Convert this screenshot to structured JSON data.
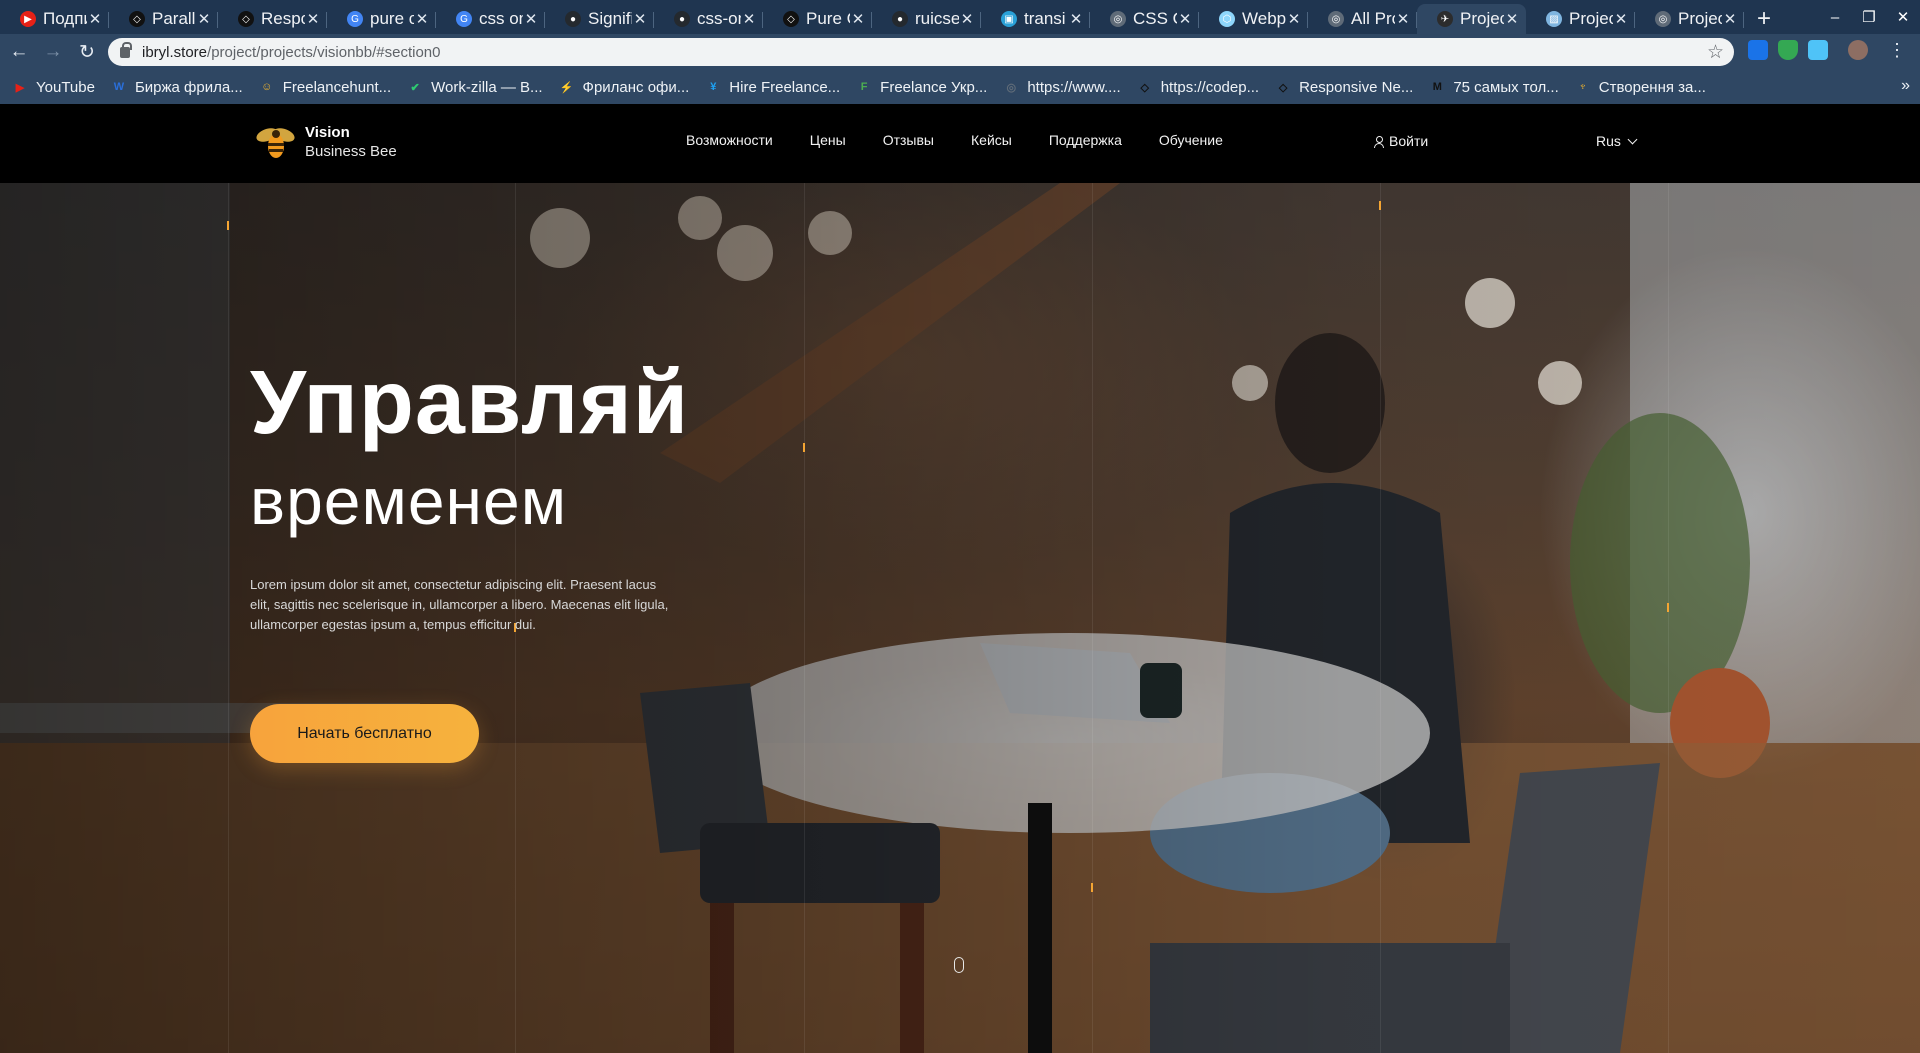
{
  "browser": {
    "tabs": [
      {
        "title": "Подпи",
        "color": "#e62117",
        "glyph": "▶"
      },
      {
        "title": "Paralla",
        "color": "#111111",
        "glyph": "◇"
      },
      {
        "title": "Respo",
        "color": "#111111",
        "glyph": "◇"
      },
      {
        "title": "pure c",
        "color": "#4285f4",
        "glyph": "G"
      },
      {
        "title": "css on",
        "color": "#4285f4",
        "glyph": "G"
      },
      {
        "title": "Signifi",
        "color": "#24292e",
        "glyph": "●"
      },
      {
        "title": "css-on",
        "color": "#24292e",
        "glyph": "●"
      },
      {
        "title": "Pure C",
        "color": "#111111",
        "glyph": "◇"
      },
      {
        "title": "ruicse",
        "color": "#24292e",
        "glyph": "●"
      },
      {
        "title": "transi",
        "color": "#2aa1d8",
        "glyph": "▣"
      },
      {
        "title": "CSS O",
        "color": "#5f6b78",
        "glyph": "◎"
      },
      {
        "title": "Webp",
        "color": "#8ed6fb",
        "glyph": "⬡"
      },
      {
        "title": "All Pro",
        "color": "#5f6b78",
        "glyph": "◎"
      },
      {
        "title": "Projec",
        "color": "#2c2c2c",
        "glyph": "✈",
        "active": true
      },
      {
        "title": "Projec",
        "color": "#7fb5e0",
        "glyph": "▨"
      },
      {
        "title": "Projec",
        "color": "#5f6b78",
        "glyph": "◎"
      }
    ],
    "new_tab_label": "+",
    "url_host": "ibryl.store",
    "url_path": "/project/projects/visionbb/#section0",
    "bookmarks": [
      {
        "label": "YouTube",
        "color": "#e62117",
        "glyph": "▶"
      },
      {
        "label": "Биржа фрила...",
        "color": "#2a6fdb",
        "glyph": "W"
      },
      {
        "label": "Freelancehunt...",
        "color": "#f3b52c",
        "glyph": "☺"
      },
      {
        "label": "Work-zilla — В...",
        "color": "#2ecc71",
        "glyph": "✔"
      },
      {
        "label": "Фриланс офи...",
        "color": "#6ab04c",
        "glyph": "⚡"
      },
      {
        "label": "Hire Freelance...",
        "color": "#1da1f2",
        "glyph": "¥"
      },
      {
        "label": "Freelance Укр...",
        "color": "#4caf50",
        "glyph": "F"
      },
      {
        "label": "https://www....",
        "color": "#5f6b78",
        "glyph": "◎"
      },
      {
        "label": "https://codep...",
        "color": "#111111",
        "glyph": "◇"
      },
      {
        "label": "Responsive Ne...",
        "color": "#111111",
        "glyph": "◇"
      },
      {
        "label": "75 самых тол...",
        "color": "#111111",
        "glyph": "M"
      },
      {
        "label": "Створення за...",
        "color": "#f3b52c",
        "glyph": "♆"
      }
    ]
  },
  "site": {
    "logo_name": "Vision",
    "logo_sub": "Business Bee",
    "nav": [
      "Возможности",
      "Цены",
      "Отзывы",
      "Кейсы",
      "Поддержка",
      "Обучение"
    ],
    "login": "Войти",
    "lang": "Rus",
    "hero": {
      "title": "Управляй",
      "subtitle": "временем",
      "text": "Lorem ipsum dolor sit amet, consectetur adipiscing elit. Praesent lacus elit, sagittis nec scelerisque in, ullamcorper a libero. Maecenas elit ligula, ullamcorper egestas ipsum a, tempus efficitur dui.",
      "cta": "Начать бесплатно"
    },
    "accent": "#f7a33c"
  }
}
